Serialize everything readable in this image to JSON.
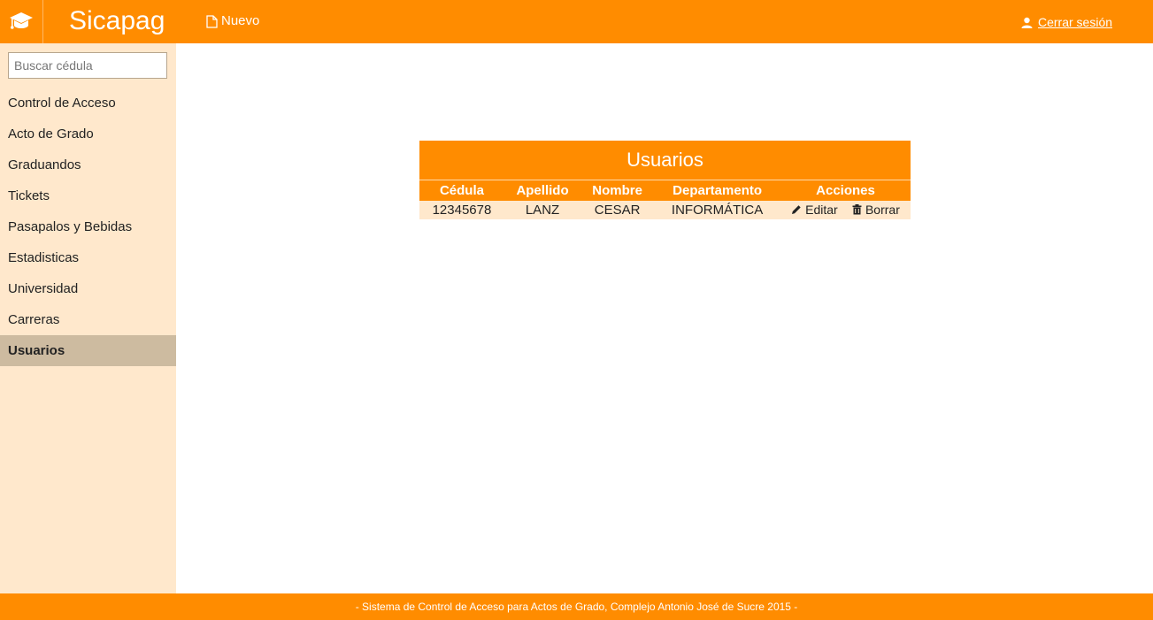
{
  "header": {
    "brand": "Sicapag",
    "logo_icon": "graduation-cap-icon",
    "new_label": "Nuevo",
    "new_icon": "document-icon",
    "logout_label": "Cerrar sesión",
    "logout_icon": "user-icon",
    "color": "#ff8c00"
  },
  "sidebar": {
    "search_placeholder": "Buscar cédula",
    "items": [
      {
        "label": "Control de Acceso"
      },
      {
        "label": "Acto de Grado"
      },
      {
        "label": "Graduandos"
      },
      {
        "label": "Tickets"
      },
      {
        "label": "Pasapalos y Bebidas"
      },
      {
        "label": "Estadisticas"
      },
      {
        "label": "Universidad"
      },
      {
        "label": "Carreras"
      },
      {
        "label": "Usuarios",
        "active": true
      }
    ]
  },
  "table": {
    "title": "Usuarios",
    "columns": [
      "Cédula",
      "Apellido",
      "Nombre",
      "Departamento",
      "Acciones"
    ],
    "rows": [
      {
        "cedula": "12345678",
        "apellido": "LANZ",
        "nombre": "CESAR",
        "departamento": "INFORMÁTICA",
        "edit_label": "Editar",
        "delete_label": "Borrar"
      }
    ]
  },
  "footer": {
    "text": "-  Sistema de Control de Acceso para Actos de Grado, Complejo Antonio José de Sucre 2015  -"
  }
}
